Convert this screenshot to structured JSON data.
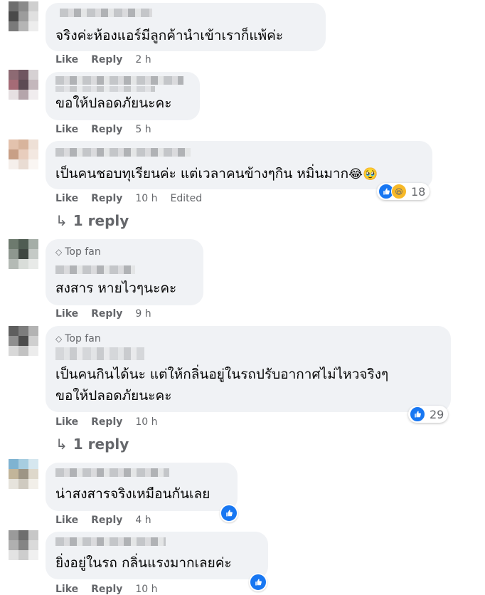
{
  "actions": {
    "like": "Like",
    "reply": "Reply"
  },
  "comments": [
    {
      "text": "จริงค่ะห้องแอร์มีลูกค้านำเข้าเราก็แพ้ค่ะ",
      "time": "2 h"
    },
    {
      "text": "ขอให้ปลอดภัยนะคะ",
      "time": "5 h"
    },
    {
      "text": "เป็นคนชอบทุเรียนค่ะ แต่เวลาคนข้างๆกิน หมิ่นมาก",
      "emoji": "😂🥹",
      "time": "10 h",
      "edited": "Edited",
      "reactions": 18,
      "reply_link": "1 reply"
    },
    {
      "badge": "Top fan",
      "text": "สงสาร หายไวๆนะคะ",
      "time": "9 h"
    },
    {
      "badge": "Top fan",
      "line1": "เป็นคนกินได้นะ แต่ให้กลิ่นอยู่ในรถปรับอากาศไม่ไหวจริงๆ",
      "line2": "ขอให้ปลอดภัยนะคะ",
      "time": "10 h",
      "reactions": 29,
      "reply_link": "1 reply"
    },
    {
      "text": "น่าสงสารจริงเหมือนกันเลย",
      "time": "4 h"
    },
    {
      "text": "ยิ่งอยู่ในรถ กลิ่นแรงมากเลยค่ะ",
      "time": "10 h"
    }
  ],
  "colors": {
    "bubble": "#f0f2f5",
    "secondary_text": "#65676b",
    "like_blue": "#1877f2"
  },
  "icons": {
    "reply_arrow": "reply-arrow-icon",
    "top_fan": "diamond-icon",
    "like_reaction": "thumbs-up-icon",
    "haha_reaction": "haha-face-icon"
  }
}
